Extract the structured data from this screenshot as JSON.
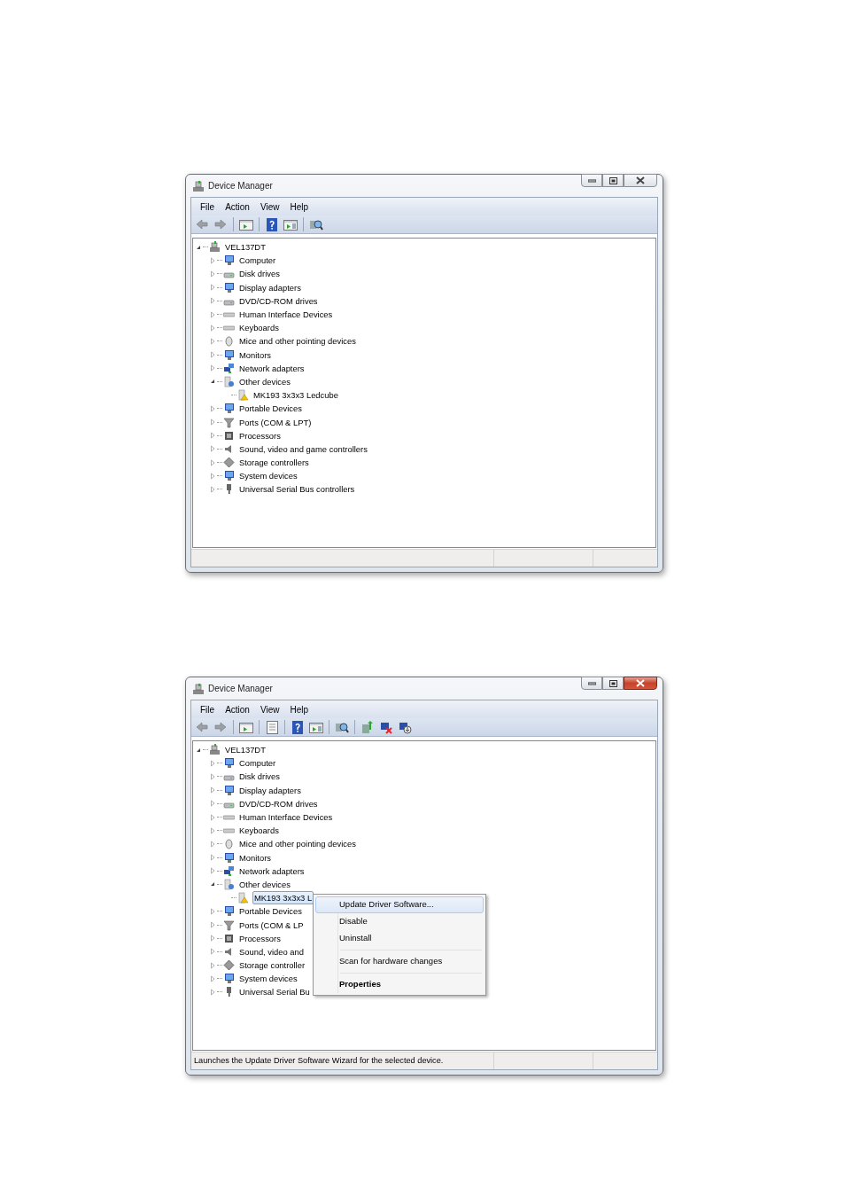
{
  "windows": [
    {
      "title": "Device Manager",
      "close_hover": false,
      "menu": [
        "File",
        "Action",
        "View",
        "Help"
      ],
      "toolbar": {
        "device_actions_shown": false
      },
      "tree": {
        "label": "VEL137DT",
        "expanded": true,
        "children": [
          {
            "label": "Computer",
            "expanded": false
          },
          {
            "label": "Disk drives",
            "expanded": false
          },
          {
            "label": "Display adapters",
            "expanded": false
          },
          {
            "label": "DVD/CD-ROM drives",
            "expanded": false
          },
          {
            "label": "Human Interface Devices",
            "expanded": false
          },
          {
            "label": "Keyboards",
            "expanded": false
          },
          {
            "label": "Mice and other pointing devices",
            "expanded": false
          },
          {
            "label": "Monitors",
            "expanded": false
          },
          {
            "label": "Network adapters",
            "expanded": false
          },
          {
            "label": "Other devices",
            "expanded": true,
            "children": [
              {
                "label": "MK193 3x3x3 Ledcube",
                "warning": true,
                "selected": false
              }
            ]
          },
          {
            "label": "Portable Devices",
            "expanded": false
          },
          {
            "label": "Ports (COM & LPT)",
            "expanded": false
          },
          {
            "label": "Processors",
            "expanded": false
          },
          {
            "label": "Sound, video and game controllers",
            "expanded": false
          },
          {
            "label": "Storage controllers",
            "expanded": false
          },
          {
            "label": "System devices",
            "expanded": false
          },
          {
            "label": "Universal Serial Bus controllers",
            "expanded": false
          }
        ]
      }
    },
    {
      "title": "Device Manager",
      "close_hover": true,
      "menu": [
        "File",
        "Action",
        "View",
        "Help"
      ],
      "toolbar": {
        "device_actions_shown": true
      },
      "tree": {
        "label": "VEL137DT",
        "expanded": true,
        "children": [
          {
            "label": "Computer",
            "expanded": false
          },
          {
            "label": "Disk drives",
            "expanded": false
          },
          {
            "label": "Display adapters",
            "expanded": false
          },
          {
            "label": "DVD/CD-ROM drives",
            "expanded": false
          },
          {
            "label": "Human Interface Devices",
            "expanded": false
          },
          {
            "label": "Keyboards",
            "expanded": false
          },
          {
            "label": "Mice and other pointing devices",
            "expanded": false
          },
          {
            "label": "Monitors",
            "expanded": false
          },
          {
            "label": "Network adapters",
            "expanded": false
          },
          {
            "label": "Other devices",
            "expanded": true,
            "children": [
              {
                "label": "MK193 3x3x3 L",
                "warning": true,
                "selected": true
              }
            ]
          },
          {
            "label": "Portable Devices",
            "expanded": false
          },
          {
            "label": "Ports (COM & LP",
            "expanded": false
          },
          {
            "label": "Processors",
            "expanded": false
          },
          {
            "label": "Sound, video and",
            "expanded": false
          },
          {
            "label": "Storage controller",
            "expanded": false
          },
          {
            "label": "System devices",
            "expanded": false
          },
          {
            "label": "Universal Serial Bu",
            "expanded": false
          }
        ]
      },
      "context_menu": [
        {
          "kind": "item",
          "label": "Update Driver Software...",
          "selected": true,
          "default": false
        },
        {
          "kind": "item",
          "label": "Disable",
          "selected": false,
          "default": false
        },
        {
          "kind": "item",
          "label": "Uninstall",
          "selected": false,
          "default": false
        },
        {
          "kind": "separator"
        },
        {
          "kind": "item",
          "label": "Scan for hardware changes",
          "selected": false,
          "default": false
        },
        {
          "kind": "separator"
        },
        {
          "kind": "item",
          "label": "Properties",
          "selected": false,
          "default": true
        }
      ],
      "status_bar": "Launches the Update Driver Software Wizard for the selected device."
    }
  ]
}
